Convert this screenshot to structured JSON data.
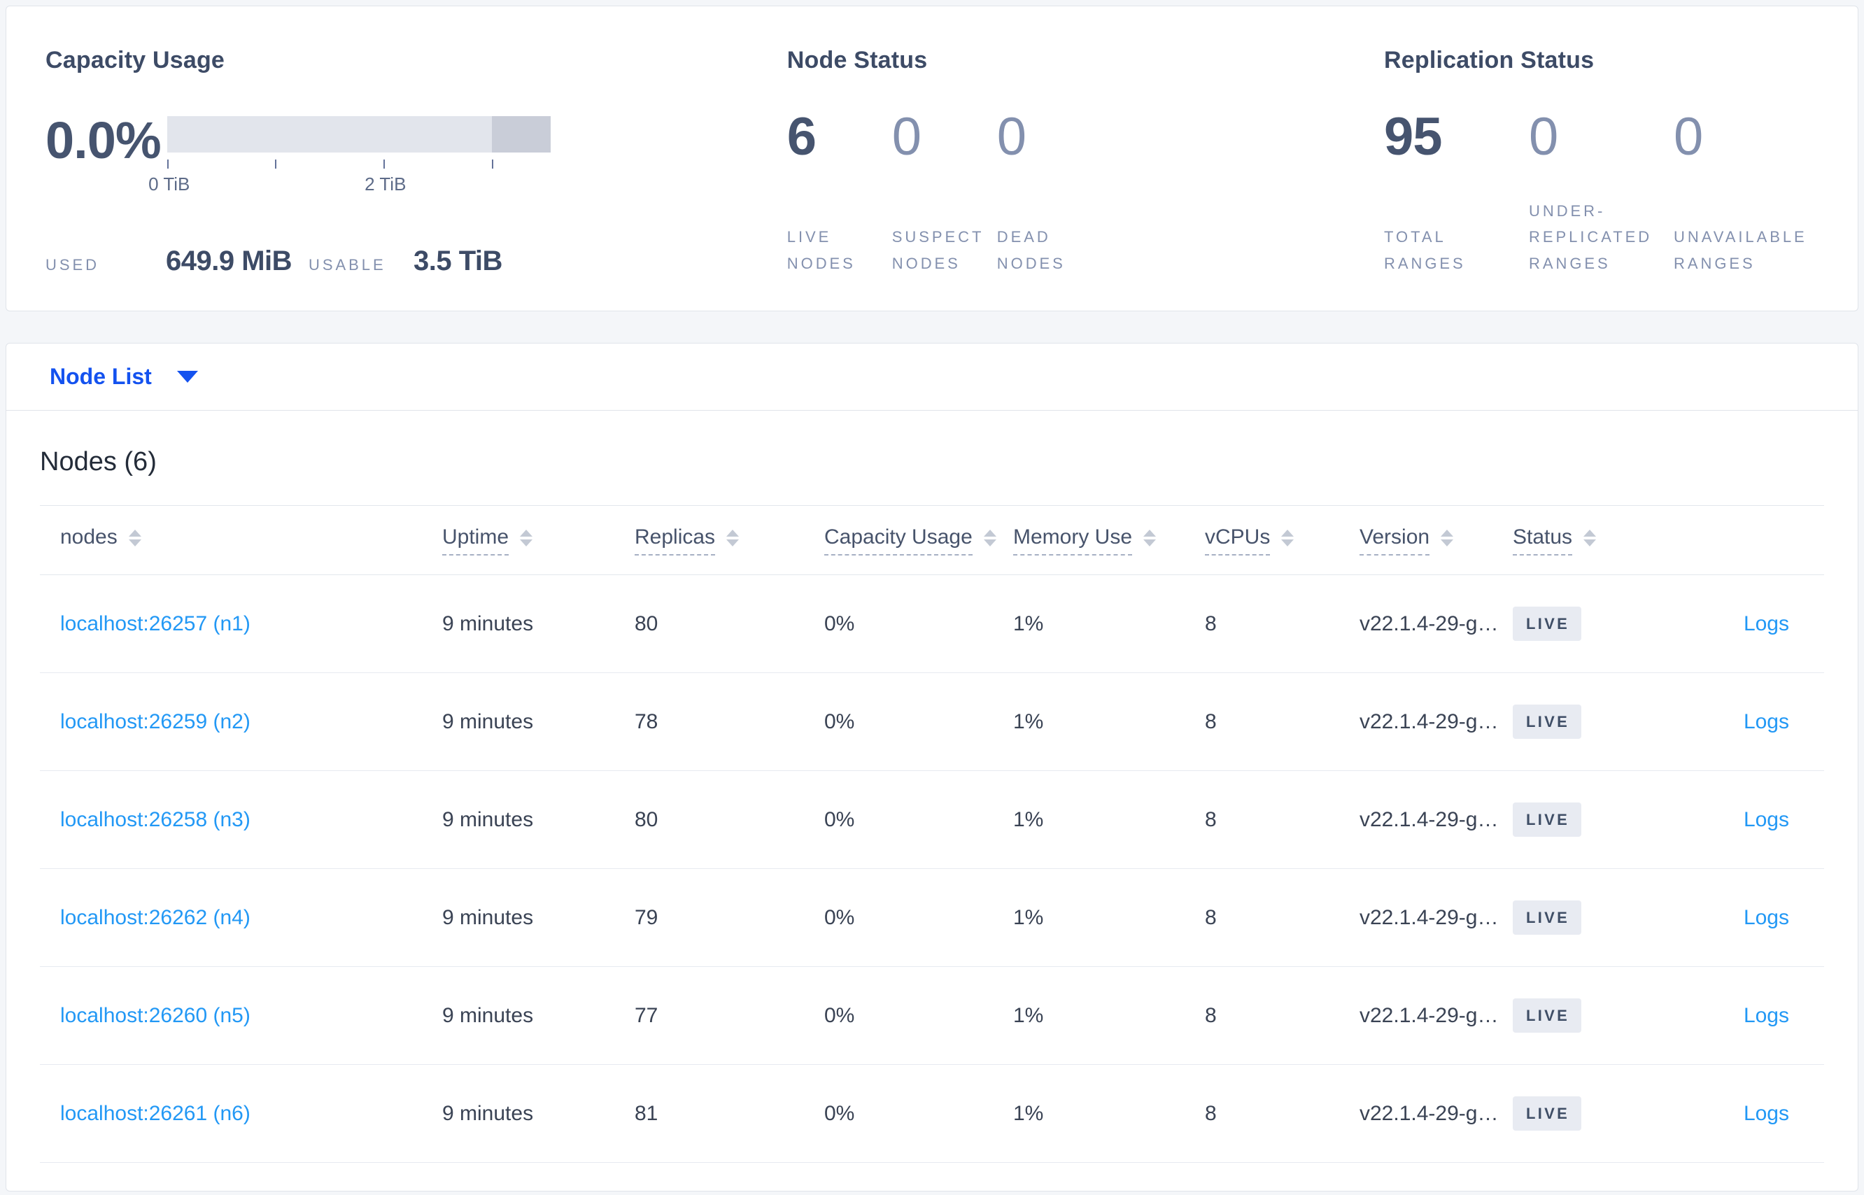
{
  "colors": {
    "link_blue": "#2298f5",
    "selector_blue": "#1452ef",
    "stat_dark": "#46546f",
    "stat_muted": "#8390ae",
    "badge_bg": "#e8ebf2",
    "badge_text": "#3f4e66",
    "gauge_track": "#e2e5ec",
    "gauge_reserved": "#c9cdd8"
  },
  "panels": {
    "capacity": {
      "title": "Capacity Usage",
      "percent": "0.0%",
      "tick_labels": [
        "0 TiB",
        "2 TiB"
      ],
      "used_label": "USED",
      "used_value": "649.9 MiB",
      "usable_label": "USABLE",
      "usable_value": "3.5 TiB"
    },
    "node_status": {
      "title": "Node Status",
      "stats": [
        {
          "value": "6",
          "label": "LIVE\nNODES",
          "muted": false
        },
        {
          "value": "0",
          "label": "SUSPECT\nNODES",
          "muted": true
        },
        {
          "value": "0",
          "label": "DEAD\nNODES",
          "muted": true
        }
      ]
    },
    "replication": {
      "title": "Replication Status",
      "stats": [
        {
          "value": "95",
          "label": "TOTAL\nRANGES",
          "muted": false
        },
        {
          "value": "0",
          "label": "UNDER-\nREPLICATED\nRANGES",
          "muted": true
        },
        {
          "value": "0",
          "label": "UNAVAILABLE\nRANGES",
          "muted": true
        }
      ]
    }
  },
  "view_selector": {
    "label": "Node List"
  },
  "table": {
    "heading": "Nodes (6)",
    "columns": [
      {
        "label": "nodes",
        "underline": false
      },
      {
        "label": "Uptime",
        "underline": true
      },
      {
        "label": "Replicas",
        "underline": true
      },
      {
        "label": "Capacity Usage",
        "underline": true
      },
      {
        "label": "Memory Use",
        "underline": true
      },
      {
        "label": "vCPUs",
        "underline": true
      },
      {
        "label": "Version",
        "underline": true
      },
      {
        "label": "Status",
        "underline": true
      }
    ],
    "rows": [
      {
        "node": "localhost:26257 (n1)",
        "uptime": "9 minutes",
        "replicas": "80",
        "capacity": "0%",
        "memory": "1%",
        "vcpus": "8",
        "version": "v22.1.4-29-g…",
        "status": "LIVE",
        "logs": "Logs"
      },
      {
        "node": "localhost:26259 (n2)",
        "uptime": "9 minutes",
        "replicas": "78",
        "capacity": "0%",
        "memory": "1%",
        "vcpus": "8",
        "version": "v22.1.4-29-g…",
        "status": "LIVE",
        "logs": "Logs"
      },
      {
        "node": "localhost:26258 (n3)",
        "uptime": "9 minutes",
        "replicas": "80",
        "capacity": "0%",
        "memory": "1%",
        "vcpus": "8",
        "version": "v22.1.4-29-g…",
        "status": "LIVE",
        "logs": "Logs"
      },
      {
        "node": "localhost:26262 (n4)",
        "uptime": "9 minutes",
        "replicas": "79",
        "capacity": "0%",
        "memory": "1%",
        "vcpus": "8",
        "version": "v22.1.4-29-g…",
        "status": "LIVE",
        "logs": "Logs"
      },
      {
        "node": "localhost:26260 (n5)",
        "uptime": "9 minutes",
        "replicas": "77",
        "capacity": "0%",
        "memory": "1%",
        "vcpus": "8",
        "version": "v22.1.4-29-g…",
        "status": "LIVE",
        "logs": "Logs"
      },
      {
        "node": "localhost:26261 (n6)",
        "uptime": "9 minutes",
        "replicas": "81",
        "capacity": "0%",
        "memory": "1%",
        "vcpus": "8",
        "version": "v22.1.4-29-g…",
        "status": "LIVE",
        "logs": "Logs"
      }
    ]
  }
}
